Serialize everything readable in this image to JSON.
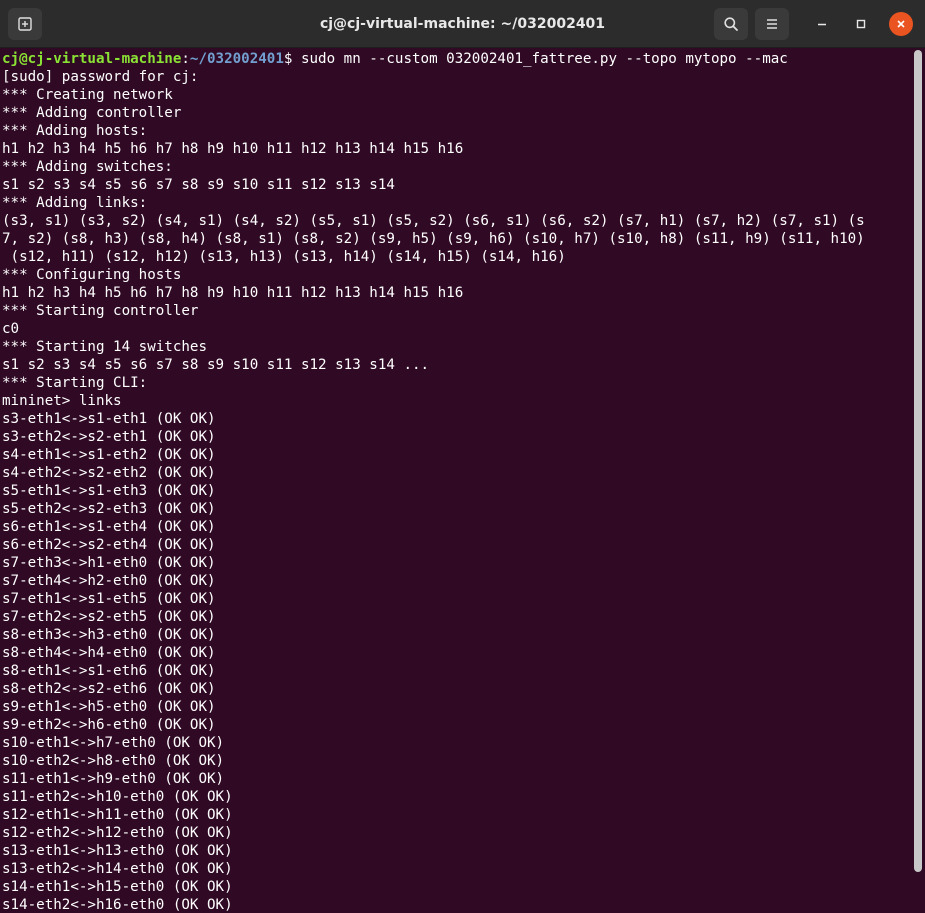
{
  "window": {
    "title": "cj@cj-virtual-machine: ~/032002401"
  },
  "titlebar": {
    "new_tab_icon": "new-tab-icon",
    "search_icon": "search-icon",
    "menu_icon": "hamburger-menu-icon",
    "minimize_icon": "minimize-icon",
    "maximize_icon": "maximize-icon",
    "close_icon": "close-icon"
  },
  "colors": {
    "terminal_background": "#300a24",
    "titlebar_background": "#2c2c2c",
    "prompt_user": "#8ae234",
    "prompt_path": "#729fcf",
    "close_button": "#e95420"
  },
  "prompt": {
    "user_host": "cj@cj-virtual-machine",
    "colon": ":",
    "path": "~/032002401",
    "symbol": "$",
    "command": " sudo mn --custom 032002401_fattree.py --topo mytopo --mac"
  },
  "output_lines": [
    "[sudo] password for cj:",
    "*** Creating network",
    "*** Adding controller",
    "*** Adding hosts:",
    "h1 h2 h3 h4 h5 h6 h7 h8 h9 h10 h11 h12 h13 h14 h15 h16",
    "*** Adding switches:",
    "s1 s2 s3 s4 s5 s6 s7 s8 s9 s10 s11 s12 s13 s14",
    "*** Adding links:",
    "(s3, s1) (s3, s2) (s4, s1) (s4, s2) (s5, s1) (s5, s2) (s6, s1) (s6, s2) (s7, h1) (s7, h2) (s7, s1) (s",
    "7, s2) (s8, h3) (s8, h4) (s8, s1) (s8, s2) (s9, h5) (s9, h6) (s10, h7) (s10, h8) (s11, h9) (s11, h10)",
    " (s12, h11) (s12, h12) (s13, h13) (s13, h14) (s14, h15) (s14, h16)",
    "*** Configuring hosts",
    "h1 h2 h3 h4 h5 h6 h7 h8 h9 h10 h11 h12 h13 h14 h15 h16",
    "*** Starting controller",
    "c0",
    "*** Starting 14 switches",
    "s1 s2 s3 s4 s5 s6 s7 s8 s9 s10 s11 s12 s13 s14 ...",
    "*** Starting CLI:",
    "mininet> links",
    "s3-eth1<->s1-eth1 (OK OK)",
    "s3-eth2<->s2-eth1 (OK OK)",
    "s4-eth1<->s1-eth2 (OK OK)",
    "s4-eth2<->s2-eth2 (OK OK)",
    "s5-eth1<->s1-eth3 (OK OK)",
    "s5-eth2<->s2-eth3 (OK OK)",
    "s6-eth1<->s1-eth4 (OK OK)",
    "s6-eth2<->s2-eth4 (OK OK)",
    "s7-eth3<->h1-eth0 (OK OK)",
    "s7-eth4<->h2-eth0 (OK OK)",
    "s7-eth1<->s1-eth5 (OK OK)",
    "s7-eth2<->s2-eth5 (OK OK)",
    "s8-eth3<->h3-eth0 (OK OK)",
    "s8-eth4<->h4-eth0 (OK OK)",
    "s8-eth1<->s1-eth6 (OK OK)",
    "s8-eth2<->s2-eth6 (OK OK)",
    "s9-eth1<->h5-eth0 (OK OK)",
    "s9-eth2<->h6-eth0 (OK OK)",
    "s10-eth1<->h7-eth0 (OK OK)",
    "s10-eth2<->h8-eth0 (OK OK)",
    "s11-eth1<->h9-eth0 (OK OK)",
    "s11-eth2<->h10-eth0 (OK OK)",
    "s12-eth1<->h11-eth0 (OK OK)",
    "s12-eth2<->h12-eth0 (OK OK)",
    "s13-eth1<->h13-eth0 (OK OK)",
    "s13-eth2<->h14-eth0 (OK OK)",
    "s14-eth1<->h15-eth0 (OK OK)",
    "s14-eth2<->h16-eth0 (OK OK)"
  ]
}
